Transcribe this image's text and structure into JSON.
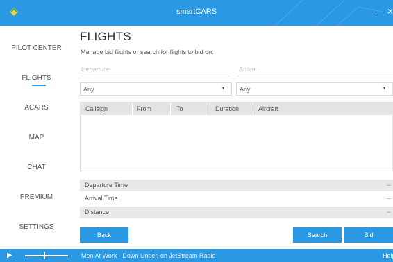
{
  "window": {
    "title": "smartCARS",
    "minimize_label": "-",
    "close_label": "×"
  },
  "sidebar": {
    "items": [
      {
        "label": "PILOT CENTER"
      },
      {
        "label": "FLIGHTS"
      },
      {
        "label": "ACARS"
      },
      {
        "label": "MAP"
      },
      {
        "label": "CHAT"
      },
      {
        "label": "PREMIUM"
      },
      {
        "label": "SETTINGS"
      }
    ],
    "active": "FLIGHTS"
  },
  "main": {
    "title": "FLIGHTS",
    "subtitle": "Manage bid flights or search for flights to bid on.",
    "departure_placeholder": "Departure",
    "arrival_placeholder": "Arrival",
    "departure_select": "Any",
    "arrival_select": "Any",
    "table": {
      "columns": [
        "Callsign",
        "From",
        "To",
        "Duration",
        "Aircraft"
      ],
      "rows": []
    },
    "details": [
      {
        "label": "Departure Time",
        "value": "--"
      },
      {
        "label": "Arrival Time",
        "value": "--"
      },
      {
        "label": "Distance",
        "value": "--"
      }
    ],
    "buttons": {
      "back": "Back",
      "search": "Search",
      "bid": "Bid"
    }
  },
  "player": {
    "now_playing": "Men At Work - Down Under, on JetStream Radio",
    "help": "Help"
  },
  "colors": {
    "accent": "#2b98e3",
    "header_bg": "#e3e3e3",
    "row_alt": "#e9e9e9"
  }
}
